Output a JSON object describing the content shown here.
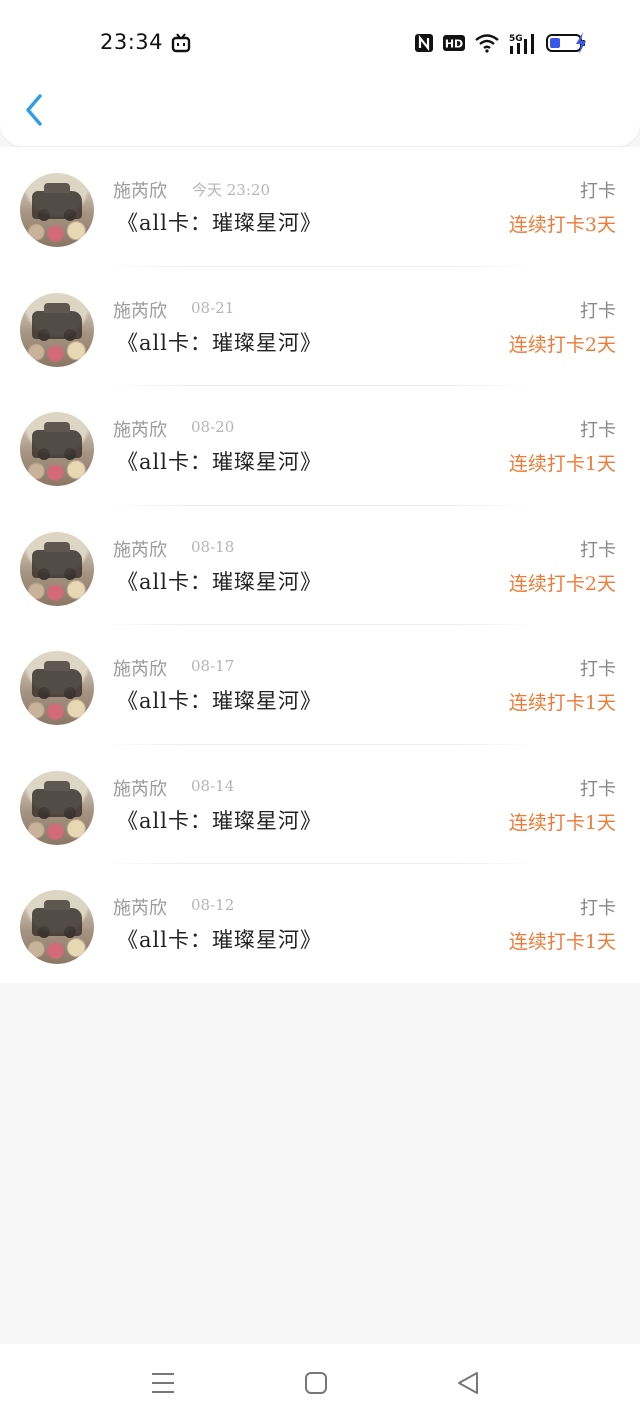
{
  "status_bar": {
    "time": "23:34"
  },
  "header": {
    "back_icon": "chevron-left-icon",
    "accent_color": "#2f9ee8"
  },
  "colors": {
    "streak": "#f07a36",
    "name": "#9a9a9a",
    "title": "#222222"
  },
  "records": [
    {
      "name": "施芮欣",
      "time": "今天 23:20",
      "book": "《all卡：璀璨星河》",
      "type": "打卡",
      "streak": "连续打卡3天"
    },
    {
      "name": "施芮欣",
      "time": "08-21",
      "book": "《all卡：璀璨星河》",
      "type": "打卡",
      "streak": "连续打卡2天"
    },
    {
      "name": "施芮欣",
      "time": "08-20",
      "book": "《all卡：璀璨星河》",
      "type": "打卡",
      "streak": "连续打卡1天"
    },
    {
      "name": "施芮欣",
      "time": "08-18",
      "book": "《all卡：璀璨星河》",
      "type": "打卡",
      "streak": "连续打卡2天"
    },
    {
      "name": "施芮欣",
      "time": "08-17",
      "book": "《all卡：璀璨星河》",
      "type": "打卡",
      "streak": "连续打卡1天"
    },
    {
      "name": "施芮欣",
      "time": "08-14",
      "book": "《all卡：璀璨星河》",
      "type": "打卡",
      "streak": "连续打卡1天"
    },
    {
      "name": "施芮欣",
      "time": "08-12",
      "book": "《all卡：璀璨星河》",
      "type": "打卡",
      "streak": "连续打卡1天"
    }
  ],
  "nav_bar": {
    "menu_icon": "menu-icon",
    "home_icon": "home-square-icon",
    "back_icon": "back-triangle-icon"
  }
}
